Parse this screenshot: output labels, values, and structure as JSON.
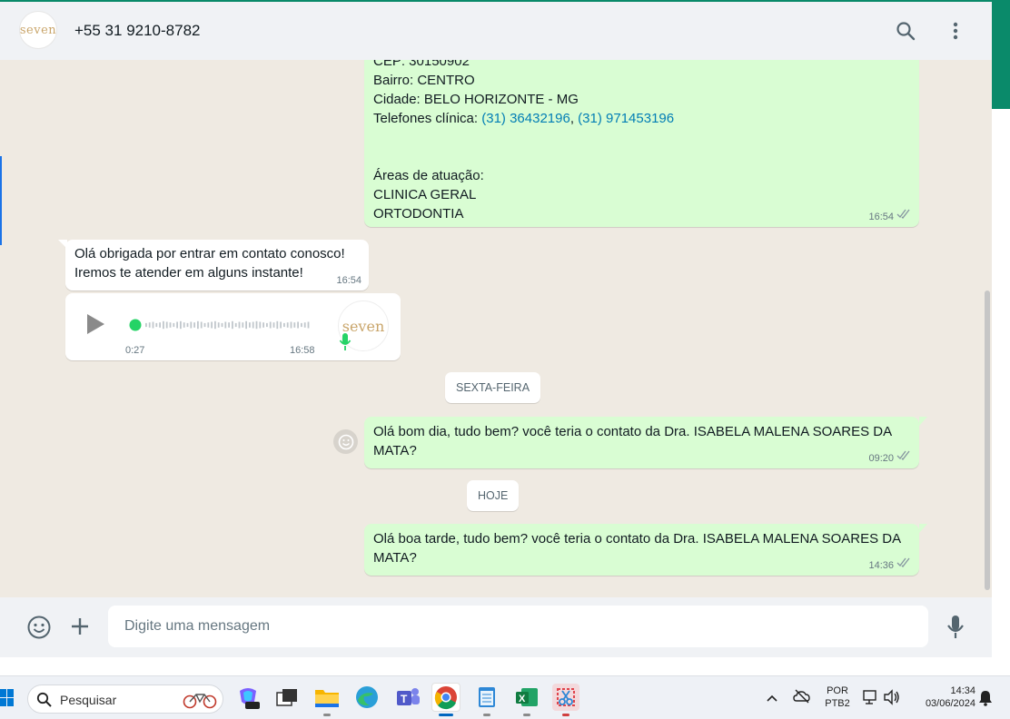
{
  "header": {
    "avatar_brand": "seven",
    "contact_name": "+55 31 9210-8782",
    "icons": [
      "search-icon",
      "menu-dots-icon"
    ]
  },
  "messages": {
    "m1": {
      "lines": [
        "CEP: 30150902",
        "Bairro: CENTRO",
        "Cidade: BELO HORIZONTE - MG"
      ],
      "phones_label": "Telefones clínica: ",
      "phone1": "(31) 36432196",
      "phone_sep": ", ",
      "phone2": "(31) 971453196",
      "areas_title": "Áreas de atuação:",
      "area1": "CLINICA GERAL",
      "area2": "ORTODONTIA",
      "time": "16:54"
    },
    "m2": {
      "line1": "Olá obrigada por entrar em contato conosco!",
      "line2": "Iremos te atender em alguns instante!",
      "time": "16:54"
    },
    "voice": {
      "duration": "0:27",
      "time": "16:58",
      "avatar_brand": "seven",
      "progress": 0
    },
    "date1": "SEXTA-FEIRA",
    "m3": {
      "line1": "Olá bom dia, tudo bem? você teria o contato da Dra. ISABELA MALENA SOARES DA",
      "line2": "MATA?",
      "time": "09:20"
    },
    "date2": "HOJE",
    "m4": {
      "line1": "Olá boa tarde, tudo bem? você teria o contato da Dra. ISABELA MALENA SOARES DA",
      "line2": "MATA?",
      "time": "14:36"
    }
  },
  "composer": {
    "placeholder": "Digite uma mensagem"
  },
  "taskbar": {
    "search_label": "Pesquisar",
    "lang_top": "POR",
    "lang_bottom": "PTB2",
    "clock_time": "14:34",
    "clock_date": "03/06/2024"
  },
  "colors": {
    "outgoing_bubble": "#d9fdd3",
    "incoming_bubble": "#ffffff",
    "chat_bg": "#efeae2",
    "header_bg": "#f0f2f5",
    "link": "#027eb5",
    "tick": "#8696a0"
  }
}
